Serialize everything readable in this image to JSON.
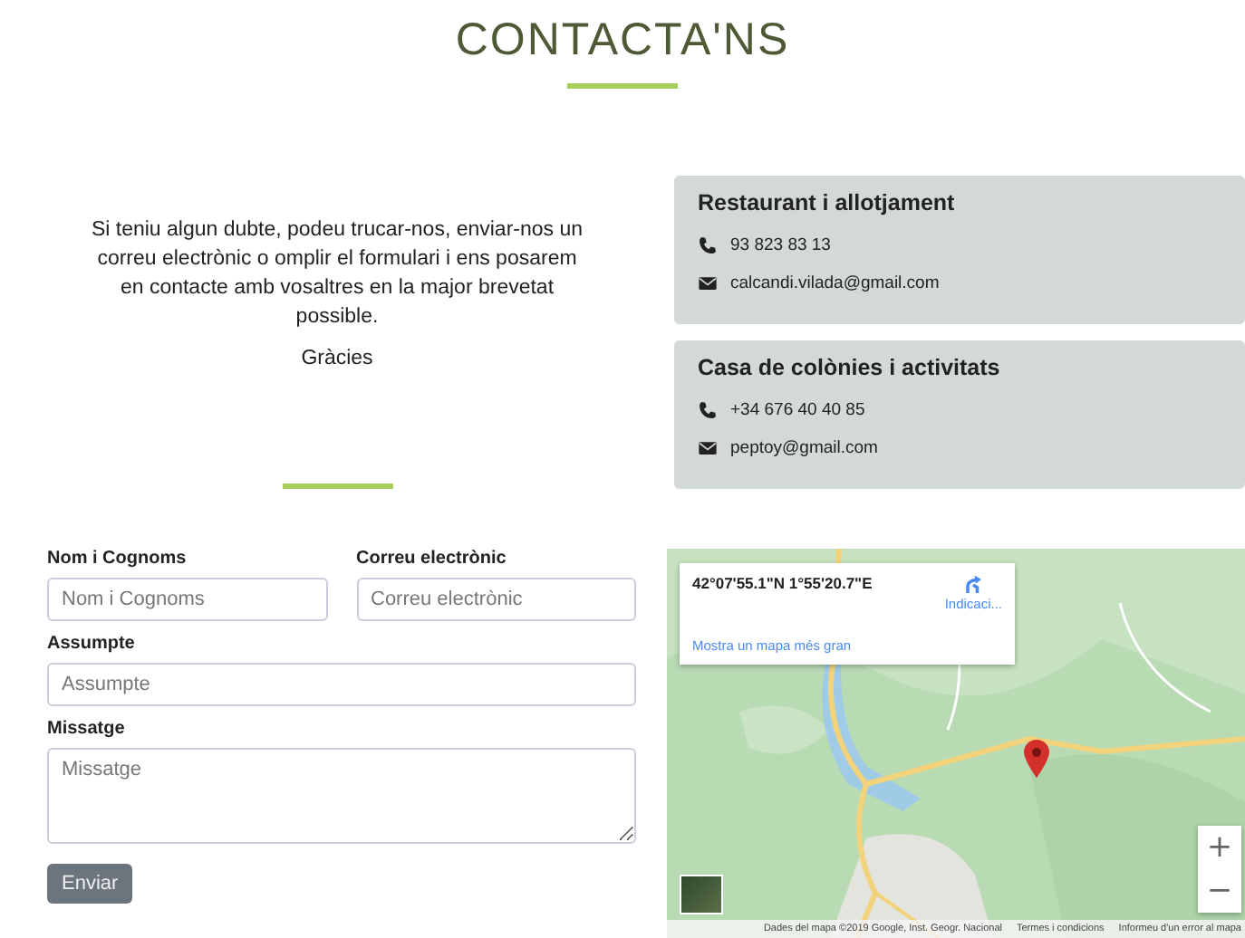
{
  "title": "CONTACTA'NS",
  "intro": {
    "text": "Si teniu algun dubte, podeu trucar-nos, enviar-nos un correu electrònic o omplir el formulari i ens posarem en contacte amb vosaltres en la major brevetat possible.",
    "thanks": "Gràcies"
  },
  "contact_cards": [
    {
      "heading": "Restaurant i allotjament",
      "lines": [
        {
          "kind": "phone",
          "text": "93 823 83 13"
        },
        {
          "kind": "email",
          "text": "calcandi.vilada@gmail.com"
        }
      ]
    },
    {
      "heading": "Casa de colònies i activitats",
      "lines": [
        {
          "kind": "phone",
          "text": "+34 676 40 40 85"
        },
        {
          "kind": "email",
          "text": "peptoy@gmail.com"
        }
      ]
    }
  ],
  "form": {
    "fields": [
      {
        "label": "Nom i Cognoms",
        "placeholder": "Nom i Cognoms",
        "kind": "input"
      },
      {
        "label": "Correu electrònic",
        "placeholder": "Correu electrònic",
        "kind": "input"
      },
      {
        "label": "Assumpte",
        "placeholder": "Assumpte",
        "kind": "input"
      },
      {
        "label": "Missatge",
        "placeholder": "Missatge",
        "kind": "textarea"
      }
    ],
    "submit": "Enviar"
  },
  "map": {
    "coordinates": "42°07'55.1\"N 1°55'20.7\"E",
    "directions": "Indicaci...",
    "larger_map_link": "Mostra un mapa més gran",
    "zoom_in": "+",
    "zoom_out": "−",
    "attribution": [
      "Dades del mapa ©2019 Google, Inst. Geogr. Nacional",
      "Termes i condicions",
      "Informeu d'un error al mapa"
    ]
  }
}
